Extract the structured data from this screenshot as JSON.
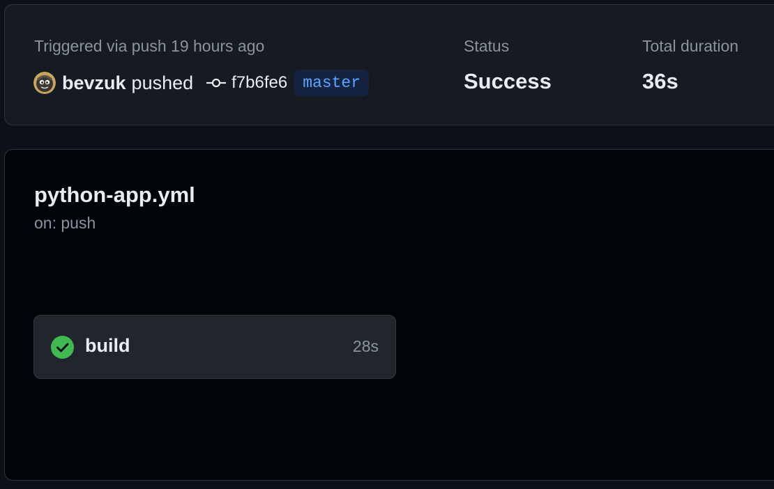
{
  "summary": {
    "trigger_text": "Triggered via push 19 hours ago",
    "actor": "bevzuk",
    "action": "pushed",
    "commit_sha": "f7b6fe6",
    "branch": "master",
    "status_label": "Status",
    "status_value": "Success",
    "duration_label": "Total duration",
    "duration_value": "36s"
  },
  "workflow": {
    "file_name": "python-app.yml",
    "event": "on: push",
    "jobs": [
      {
        "name": "build",
        "duration": "28s",
        "status": "success",
        "icon": "check-circle-icon"
      }
    ]
  },
  "colors": {
    "page_bg": "#0d1117",
    "card_bg": "#161b22",
    "graph_bg": "#010409",
    "border": "#30363d",
    "muted_text": "#8b949e",
    "branch_text": "#58a6ff",
    "branch_bg": "#152341",
    "success_green": "#3fb950"
  },
  "icons": {
    "avatar": "avatar",
    "commit": "git-commit-icon",
    "job_status": "check-circle-icon"
  }
}
